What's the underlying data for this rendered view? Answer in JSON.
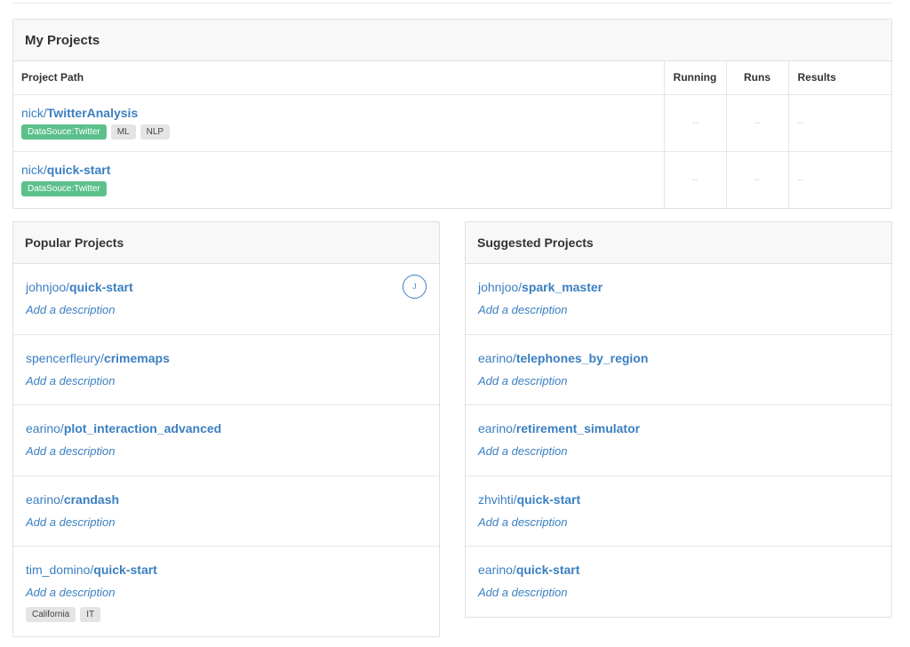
{
  "my_projects": {
    "title": "My Projects",
    "columns": {
      "path": "Project Path",
      "running": "Running",
      "runs": "Runs",
      "results": "Results"
    },
    "rows": [
      {
        "owner": "nick/",
        "name": "TwitterAnalysis",
        "tags": [
          "DataSouce:Twitter",
          "ML",
          "NLP"
        ],
        "running": "--",
        "runs": "--",
        "results": "--"
      },
      {
        "owner": "nick/",
        "name": "quick-start",
        "tags": [
          "DataSouce:Twitter"
        ],
        "running": "--",
        "runs": "--",
        "results": "--"
      }
    ]
  },
  "popular": {
    "title": "Popular Projects",
    "items": [
      {
        "owner": "johnjoo/",
        "name": "quick-start",
        "desc": "Add a description",
        "avatar": "J"
      },
      {
        "owner": "spencerfleury/",
        "name": "crimemaps",
        "desc": "Add a description"
      },
      {
        "owner": "earino/",
        "name": "plot_interaction_advanced",
        "desc": "Add a description"
      },
      {
        "owner": "earino/",
        "name": "crandash",
        "desc": "Add a description"
      },
      {
        "owner": "tim_domino/",
        "name": "quick-start",
        "desc": "Add a description",
        "tags": [
          "California",
          "IT"
        ]
      }
    ]
  },
  "suggested": {
    "title": "Suggested Projects",
    "items": [
      {
        "owner": "johnjoo/",
        "name": "spark_master",
        "desc": "Add a description"
      },
      {
        "owner": "earino/",
        "name": "telephones_by_region",
        "desc": "Add a description"
      },
      {
        "owner": "earino/",
        "name": "retirement_simulator",
        "desc": "Add a description"
      },
      {
        "owner": "zhvihti/",
        "name": "quick-start",
        "desc": "Add a description"
      },
      {
        "owner": "earino/",
        "name": "quick-start",
        "desc": "Add a description"
      }
    ]
  },
  "colors": {
    "link": "#3a7fc1",
    "tag_green": "#5cc08b",
    "tag_gray": "#e4e4e4"
  }
}
